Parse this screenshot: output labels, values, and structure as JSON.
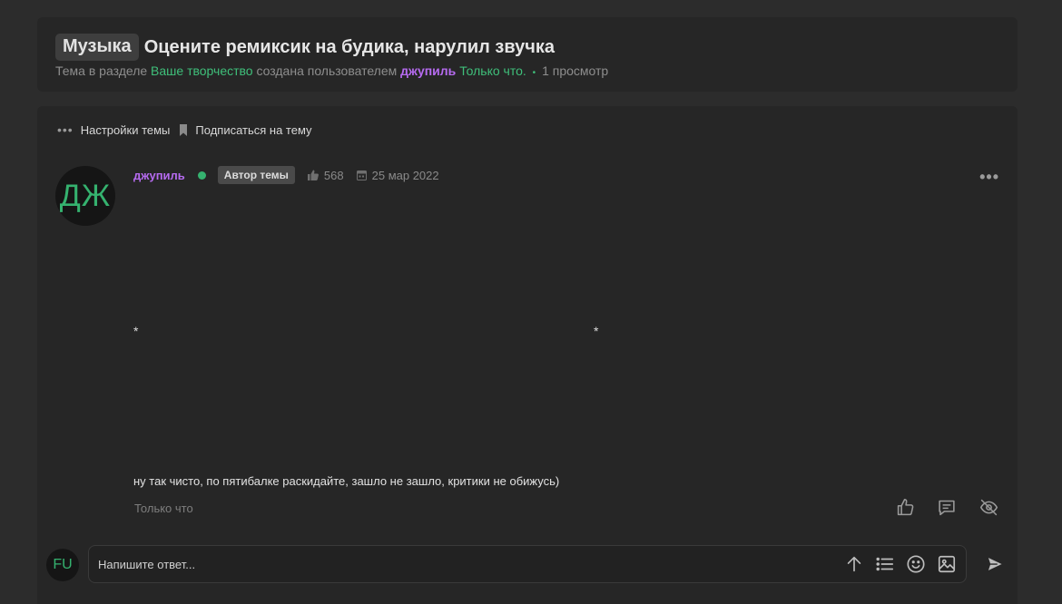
{
  "header": {
    "prefix": "Музыка",
    "title": "Оцените ремиксик на будика, нарулил звучка",
    "meta": {
      "lead": "Тема в разделе",
      "section": "Ваше творчество",
      "created_by": "создана пользователем",
      "author": "джупиль",
      "time": "Только что.",
      "views": "1 просмотр"
    }
  },
  "thread_actions": {
    "settings_label": "Настройки темы",
    "subscribe_label": "Подписаться на тему"
  },
  "post": {
    "avatar_initials": "ДЖ",
    "author": "джупиль",
    "badge": "Автор темы",
    "likes": "568",
    "date": "25 мар 2022",
    "star_left": "*",
    "star_right": "*",
    "text": "ну так чисто, по пятибалке раскидайте, зашло не зашло, критики не обижусь)",
    "time": "Только что"
  },
  "reply": {
    "avatar_initials": "FU",
    "placeholder": "Напишите ответ..."
  },
  "icons": {
    "more": "more-dots-icon",
    "bookmark": "bookmark-icon",
    "like": "thumbs-up-icon",
    "calendar": "calendar-icon",
    "comment": "comment-icon",
    "hide": "eye-off-icon",
    "upload": "arrow-up-icon",
    "list": "list-icon",
    "emoji": "smiley-icon",
    "image": "image-icon",
    "send": "send-icon"
  },
  "colors": {
    "green": "#3fbf7a",
    "purple": "#b66bf0",
    "background": "#2c2c2c",
    "card": "#262626"
  }
}
